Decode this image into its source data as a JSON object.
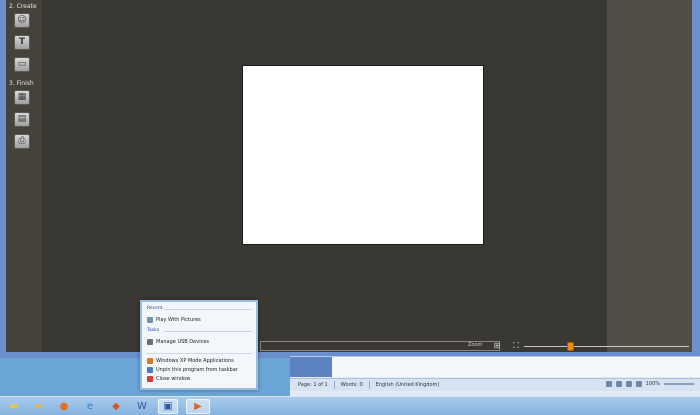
{
  "app": {
    "left_rail": {
      "section_create": "2. Create",
      "section_finish": "3. Finish",
      "create_tools": [
        {
          "name": "effects-tool",
          "icon": "effects-icon"
        },
        {
          "name": "title-tool",
          "icon": "text-icon"
        },
        {
          "name": "caption-tool",
          "icon": "speech-bubble-icon"
        }
      ],
      "finish_tools": [
        {
          "name": "save-movie-tool",
          "icon": "film-icon"
        },
        {
          "name": "save-project-tool",
          "icon": "save-icon"
        },
        {
          "name": "print-tool",
          "icon": "printer-icon"
        }
      ]
    },
    "bottom_bar": {
      "zoom_label": "Zoom",
      "zoom_level": 0.28
    }
  },
  "jump_list": {
    "section_recent": "Recent",
    "recent_items": [
      "Play With Pictures"
    ],
    "section_tasks": "Tasks",
    "task_items": [
      "Manage USB Devices"
    ],
    "system_items": [
      "Windows XP Mode Applications",
      "Unpin this program from taskbar",
      "Close window"
    ]
  },
  "word_status": {
    "page": "Page: 1 of 1",
    "words": "Words: 0",
    "language": "English (United Kingdom)",
    "zoom": "100%"
  },
  "taskbar": {
    "items": [
      {
        "name": "taskbar-start-explorer",
        "icon": "folder-icon"
      },
      {
        "name": "taskbar-firefox",
        "icon": "firefox-icon"
      },
      {
        "name": "taskbar-ie",
        "icon": "internet-explorer-icon"
      },
      {
        "name": "taskbar-media",
        "icon": "media-icon"
      },
      {
        "name": "taskbar-word",
        "icon": "word-icon"
      },
      {
        "name": "taskbar-word-active",
        "icon": "word-doc-icon"
      },
      {
        "name": "taskbar-movie-app",
        "icon": "movie-app-icon"
      }
    ]
  },
  "colors": {
    "accent_orange": "#f08a1e",
    "canvas_bg": "#3a3832",
    "window_frame": "#6b8fcf"
  }
}
